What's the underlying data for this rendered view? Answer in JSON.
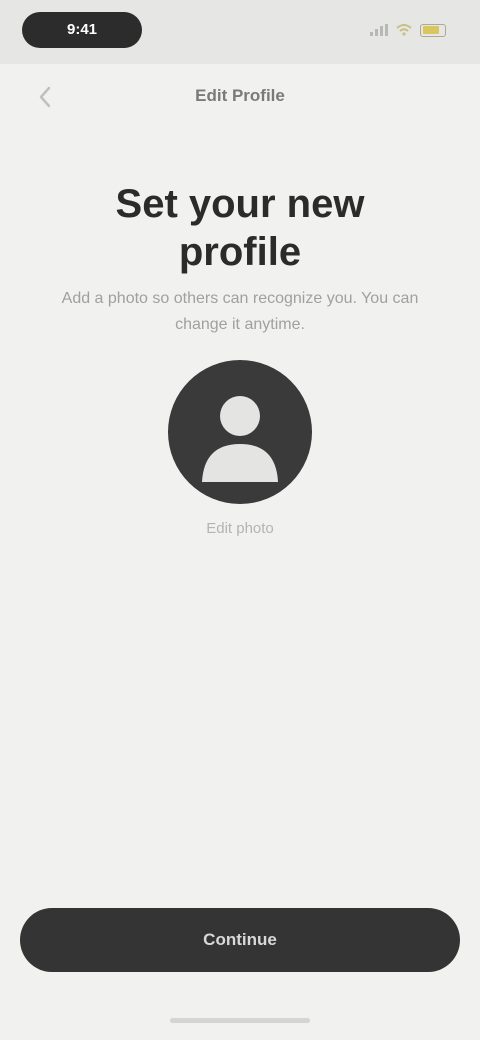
{
  "status_bar": {
    "time": "9:41",
    "icons": [
      "signal-icon",
      "wifi-icon",
      "battery-icon"
    ],
    "battery_color": "#d8c660"
  },
  "header": {
    "back_icon": "chevron-left-icon",
    "title": "Edit Profile"
  },
  "main": {
    "title": "Set your new profile",
    "subtitle": "Add a photo so others can recognize you. You can change it anytime.",
    "avatar_icon": "person-silhouette-icon",
    "avatar_caption": "Edit photo"
  },
  "footer": {
    "button_label": "Continue"
  },
  "colors": {
    "background": "#f1f1ef",
    "primary_dark": "#343434",
    "text_dark": "#2b2b2b",
    "text_muted": "#a0a09c"
  }
}
